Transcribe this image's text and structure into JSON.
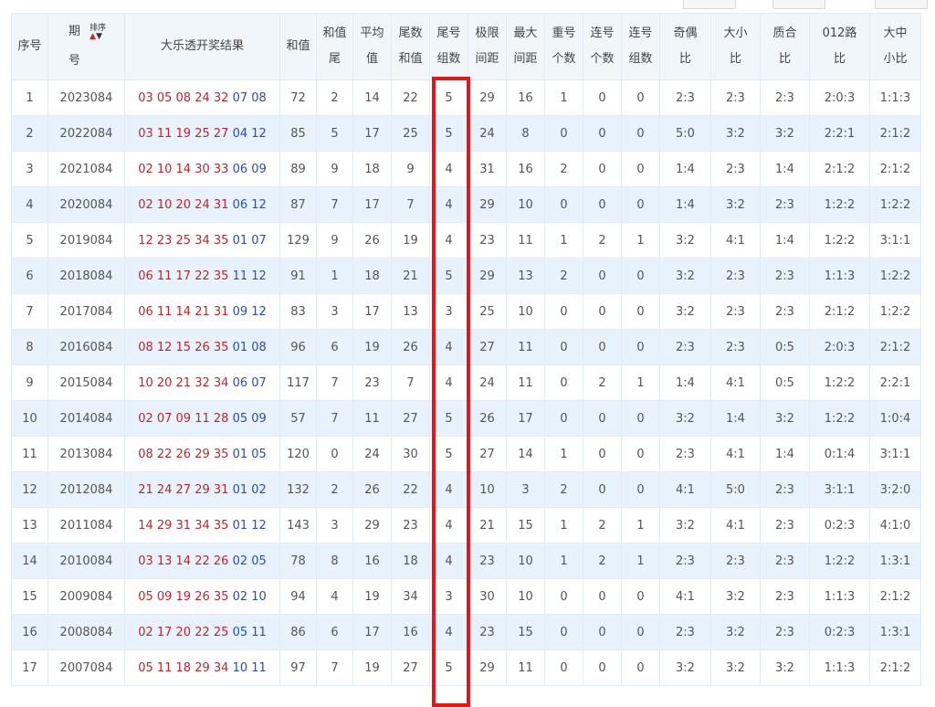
{
  "headers": {
    "seq": "序号",
    "period_top": "期",
    "period_bottom": "号",
    "sort": "排序",
    "result": "大乐透开奖结果",
    "sum": "和值",
    "sum_tail_1": "和值",
    "sum_tail_2": "尾",
    "avg_1": "平均",
    "avg_2": "值",
    "tail_sum_1": "尾数",
    "tail_sum_2": "和值",
    "tail_groups_1": "尾号",
    "tail_groups_2": "组数",
    "limit_gap_1": "极限",
    "limit_gap_2": "间距",
    "max_gap_1": "最大",
    "max_gap_2": "间距",
    "repeat_1": "重号",
    "repeat_2": "个数",
    "consec_cnt_1": "连号",
    "consec_cnt_2": "个数",
    "consec_grp_1": "连号",
    "consec_grp_2": "组数",
    "odd_even_1": "奇偶",
    "odd_even_2": "比",
    "big_small_1": "大小",
    "big_small_2": "比",
    "prime_1": "质合",
    "prime_2": "比",
    "road_1": "012路",
    "road_2": "比",
    "bms_1": "大中",
    "bms_2": "小比"
  },
  "rows": [
    {
      "seq": "1",
      "period": "2023084",
      "red": "03 05 08 24 32",
      "blue": "07 08",
      "sum": "72",
      "sum_tail": "2",
      "avg": "14",
      "tail_sum": "22",
      "tail_groups": "5",
      "limit_gap": "29",
      "max_gap": "16",
      "repeat": "1",
      "consec_cnt": "0",
      "consec_grp": "0",
      "odd_even": "2:3",
      "big_small": "2:3",
      "prime": "2:3",
      "road": "2:0:3",
      "bms": "1:1:3"
    },
    {
      "seq": "2",
      "period": "2022084",
      "red": "03 11 19 25 27",
      "blue": "04 12",
      "sum": "85",
      "sum_tail": "5",
      "avg": "17",
      "tail_sum": "25",
      "tail_groups": "5",
      "limit_gap": "24",
      "max_gap": "8",
      "repeat": "0",
      "consec_cnt": "0",
      "consec_grp": "0",
      "odd_even": "5:0",
      "big_small": "3:2",
      "prime": "3:2",
      "road": "2:2:1",
      "bms": "2:1:2"
    },
    {
      "seq": "3",
      "period": "2021084",
      "red": "02 10 14 30 33",
      "blue": "06 09",
      "sum": "89",
      "sum_tail": "9",
      "avg": "18",
      "tail_sum": "9",
      "tail_groups": "4",
      "limit_gap": "31",
      "max_gap": "16",
      "repeat": "2",
      "consec_cnt": "0",
      "consec_grp": "0",
      "odd_even": "1:4",
      "big_small": "2:3",
      "prime": "1:4",
      "road": "2:1:2",
      "bms": "2:1:2"
    },
    {
      "seq": "4",
      "period": "2020084",
      "red": "02 10 20 24 31",
      "blue": "06 12",
      "sum": "87",
      "sum_tail": "7",
      "avg": "17",
      "tail_sum": "7",
      "tail_groups": "4",
      "limit_gap": "29",
      "max_gap": "10",
      "repeat": "0",
      "consec_cnt": "0",
      "consec_grp": "0",
      "odd_even": "1:4",
      "big_small": "3:2",
      "prime": "2:3",
      "road": "1:2:2",
      "bms": "1:2:2"
    },
    {
      "seq": "5",
      "period": "2019084",
      "red": "12 23 25 34 35",
      "blue": "01 07",
      "sum": "129",
      "sum_tail": "9",
      "avg": "26",
      "tail_sum": "19",
      "tail_groups": "4",
      "limit_gap": "23",
      "max_gap": "11",
      "repeat": "1",
      "consec_cnt": "2",
      "consec_grp": "1",
      "odd_even": "3:2",
      "big_small": "4:1",
      "prime": "1:4",
      "road": "1:2:2",
      "bms": "3:1:1"
    },
    {
      "seq": "6",
      "period": "2018084",
      "red": "06 11 17 22 35",
      "blue": "11 12",
      "sum": "91",
      "sum_tail": "1",
      "avg": "18",
      "tail_sum": "21",
      "tail_groups": "5",
      "limit_gap": "29",
      "max_gap": "13",
      "repeat": "2",
      "consec_cnt": "0",
      "consec_grp": "0",
      "odd_even": "3:2",
      "big_small": "2:3",
      "prime": "2:3",
      "road": "1:1:3",
      "bms": "1:2:2"
    },
    {
      "seq": "7",
      "period": "2017084",
      "red": "06 11 14 21 31",
      "blue": "09 12",
      "sum": "83",
      "sum_tail": "3",
      "avg": "17",
      "tail_sum": "13",
      "tail_groups": "3",
      "limit_gap": "25",
      "max_gap": "10",
      "repeat": "0",
      "consec_cnt": "0",
      "consec_grp": "0",
      "odd_even": "3:2",
      "big_small": "2:3",
      "prime": "2:3",
      "road": "2:1:2",
      "bms": "1:2:2"
    },
    {
      "seq": "8",
      "period": "2016084",
      "red": "08 12 15 26 35",
      "blue": "01 08",
      "sum": "96",
      "sum_tail": "6",
      "avg": "19",
      "tail_sum": "26",
      "tail_groups": "4",
      "limit_gap": "27",
      "max_gap": "11",
      "repeat": "0",
      "consec_cnt": "0",
      "consec_grp": "0",
      "odd_even": "2:3",
      "big_small": "2:3",
      "prime": "0:5",
      "road": "2:0:3",
      "bms": "2:1:2"
    },
    {
      "seq": "9",
      "period": "2015084",
      "red": "10 20 21 32 34",
      "blue": "06 07",
      "sum": "117",
      "sum_tail": "7",
      "avg": "23",
      "tail_sum": "7",
      "tail_groups": "4",
      "limit_gap": "24",
      "max_gap": "11",
      "repeat": "0",
      "consec_cnt": "2",
      "consec_grp": "1",
      "odd_even": "1:4",
      "big_small": "4:1",
      "prime": "0:5",
      "road": "1:2:2",
      "bms": "2:2:1"
    },
    {
      "seq": "10",
      "period": "2014084",
      "red": "02 07 09 11 28",
      "blue": "05 09",
      "sum": "57",
      "sum_tail": "7",
      "avg": "11",
      "tail_sum": "27",
      "tail_groups": "5",
      "limit_gap": "26",
      "max_gap": "17",
      "repeat": "0",
      "consec_cnt": "0",
      "consec_grp": "0",
      "odd_even": "3:2",
      "big_small": "1:4",
      "prime": "3:2",
      "road": "1:2:2",
      "bms": "1:0:4"
    },
    {
      "seq": "11",
      "period": "2013084",
      "red": "08 22 26 29 35",
      "blue": "01 05",
      "sum": "120",
      "sum_tail": "0",
      "avg": "24",
      "tail_sum": "30",
      "tail_groups": "5",
      "limit_gap": "27",
      "max_gap": "14",
      "repeat": "1",
      "consec_cnt": "0",
      "consec_grp": "0",
      "odd_even": "2:3",
      "big_small": "4:1",
      "prime": "1:4",
      "road": "0:1:4",
      "bms": "3:1:1"
    },
    {
      "seq": "12",
      "period": "2012084",
      "red": "21 24 27 29 31",
      "blue": "01 02",
      "sum": "132",
      "sum_tail": "2",
      "avg": "26",
      "tail_sum": "22",
      "tail_groups": "4",
      "limit_gap": "10",
      "max_gap": "3",
      "repeat": "2",
      "consec_cnt": "0",
      "consec_grp": "0",
      "odd_even": "4:1",
      "big_small": "5:0",
      "prime": "2:3",
      "road": "3:1:1",
      "bms": "3:2:0"
    },
    {
      "seq": "13",
      "period": "2011084",
      "red": "14 29 31 34 35",
      "blue": "01 12",
      "sum": "143",
      "sum_tail": "3",
      "avg": "29",
      "tail_sum": "23",
      "tail_groups": "4",
      "limit_gap": "21",
      "max_gap": "15",
      "repeat": "1",
      "consec_cnt": "2",
      "consec_grp": "1",
      "odd_even": "3:2",
      "big_small": "4:1",
      "prime": "2:3",
      "road": "0:2:3",
      "bms": "4:1:0"
    },
    {
      "seq": "14",
      "period": "2010084",
      "red": "03 13 14 22 26",
      "blue": "02 05",
      "sum": "78",
      "sum_tail": "8",
      "avg": "16",
      "tail_sum": "18",
      "tail_groups": "4",
      "limit_gap": "23",
      "max_gap": "10",
      "repeat": "1",
      "consec_cnt": "2",
      "consec_grp": "1",
      "odd_even": "2:3",
      "big_small": "2:3",
      "prime": "2:3",
      "road": "1:2:2",
      "bms": "1:3:1"
    },
    {
      "seq": "15",
      "period": "2009084",
      "red": "05 09 19 26 35",
      "blue": "02 10",
      "sum": "94",
      "sum_tail": "4",
      "avg": "19",
      "tail_sum": "34",
      "tail_groups": "3",
      "limit_gap": "30",
      "max_gap": "10",
      "repeat": "0",
      "consec_cnt": "0",
      "consec_grp": "0",
      "odd_even": "4:1",
      "big_small": "3:2",
      "prime": "2:3",
      "road": "1:1:3",
      "bms": "2:1:2"
    },
    {
      "seq": "16",
      "period": "2008084",
      "red": "02 17 20 22 25",
      "blue": "05 11",
      "sum": "86",
      "sum_tail": "6",
      "avg": "17",
      "tail_sum": "16",
      "tail_groups": "4",
      "limit_gap": "23",
      "max_gap": "15",
      "repeat": "0",
      "consec_cnt": "0",
      "consec_grp": "0",
      "odd_even": "2:3",
      "big_small": "3:2",
      "prime": "2:3",
      "road": "0:2:3",
      "bms": "1:3:1"
    },
    {
      "seq": "17",
      "period": "2007084",
      "red": "05 11 18 29 34",
      "blue": "10 11",
      "sum": "97",
      "sum_tail": "7",
      "avg": "19",
      "tail_sum": "27",
      "tail_groups": "5",
      "limit_gap": "29",
      "max_gap": "11",
      "repeat": "0",
      "consec_cnt": "0",
      "consec_grp": "0",
      "odd_even": "3:2",
      "big_small": "3:2",
      "prime": "3:2",
      "road": "1:1:3",
      "bms": "2:1:2"
    }
  ],
  "highlight_color": "#e8141a",
  "red_ball_color": "#c0252a",
  "blue_ball_color": "#2a4db5"
}
